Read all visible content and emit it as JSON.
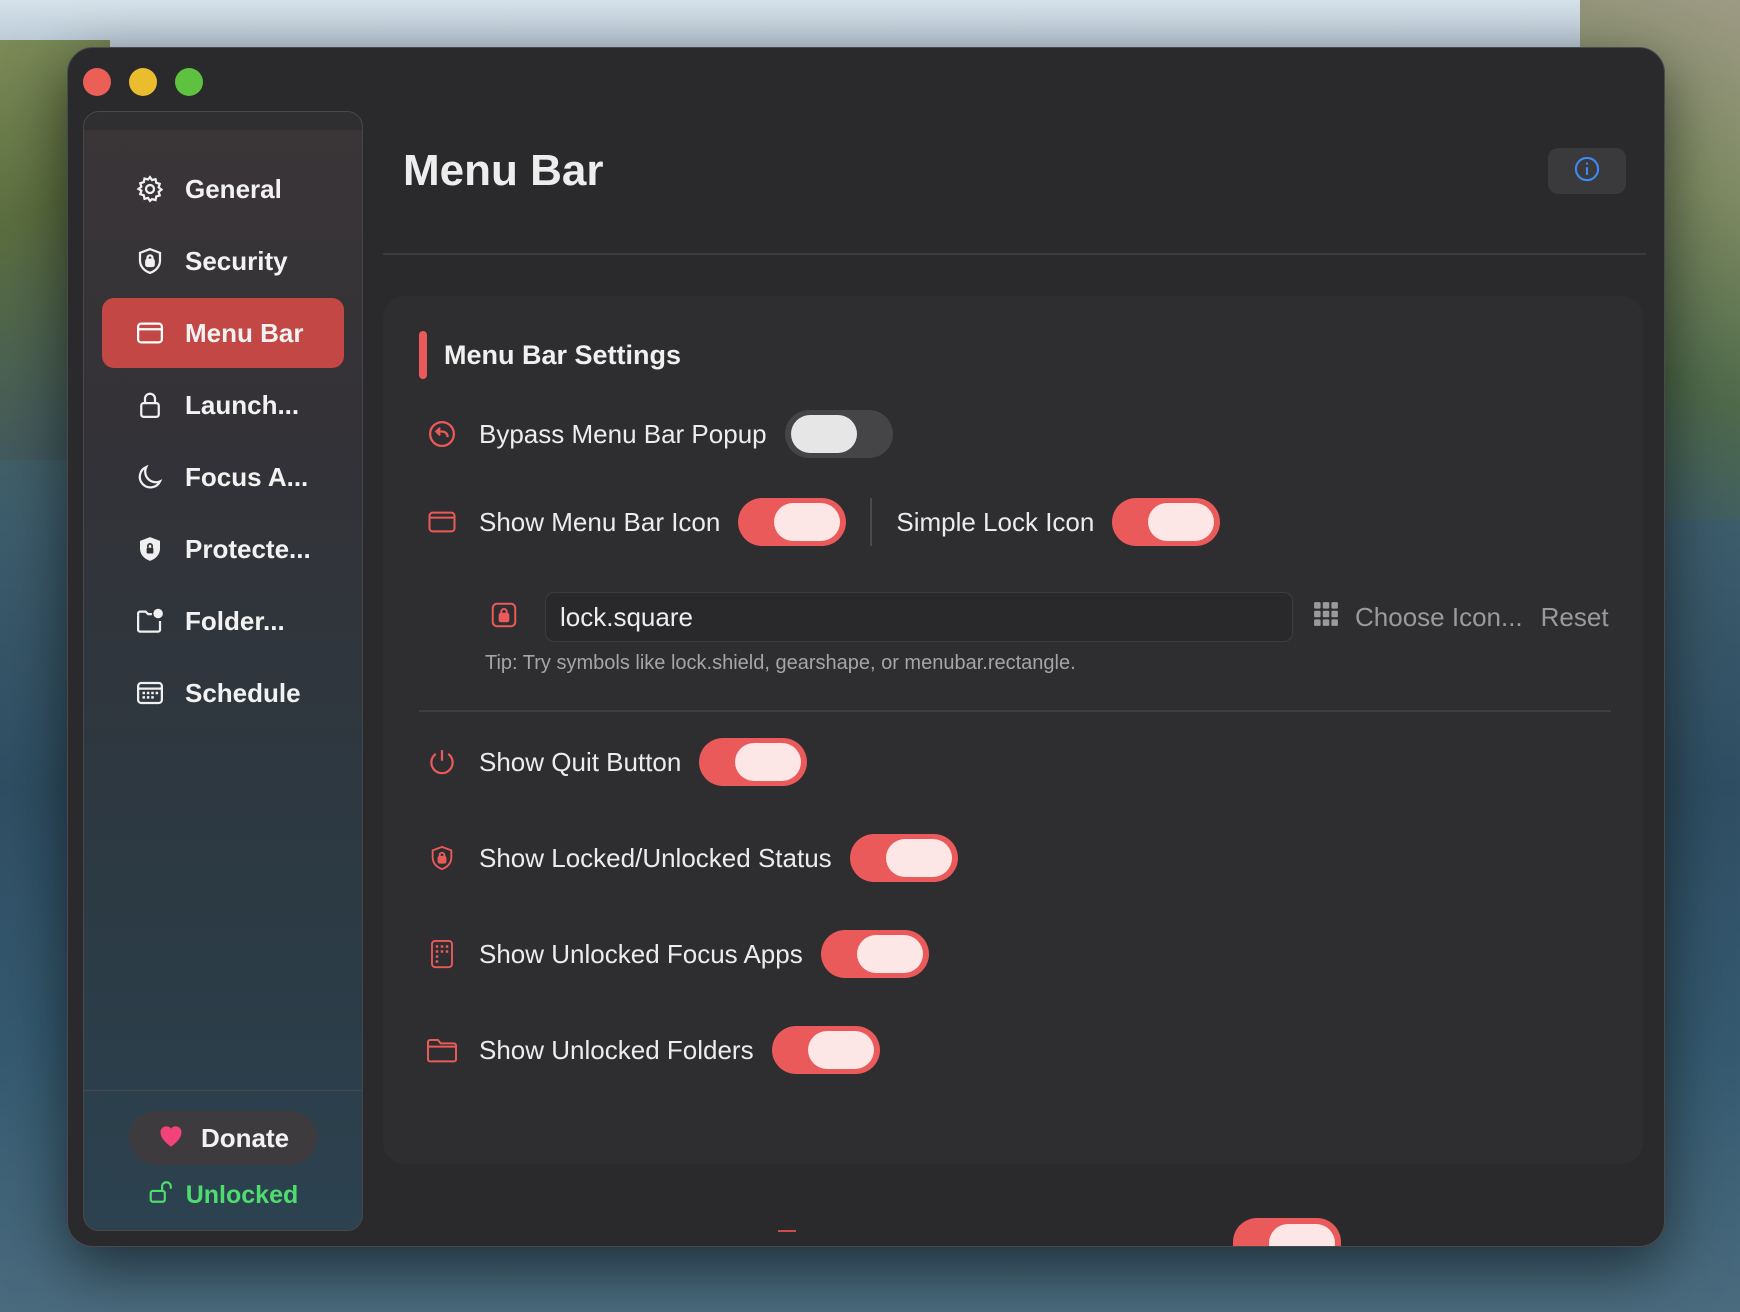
{
  "window": {
    "title": ""
  },
  "sidebar": {
    "items": [
      {
        "id": "general",
        "label": "General",
        "icon": "gear-icon",
        "active": false
      },
      {
        "id": "security",
        "label": "Security",
        "icon": "shield-lock-icon",
        "active": false
      },
      {
        "id": "menu-bar",
        "label": "Menu Bar",
        "icon": "menubar-rectangle-icon",
        "active": true
      },
      {
        "id": "launch",
        "label": "Launch...",
        "icon": "lock-icon",
        "active": false
      },
      {
        "id": "focus",
        "label": "Focus A...",
        "icon": "moon-icon",
        "active": false
      },
      {
        "id": "protected",
        "label": "Protecte...",
        "icon": "shield-badge-icon",
        "active": false
      },
      {
        "id": "folder",
        "label": "Folder...",
        "icon": "folder-badge-icon",
        "active": false
      },
      {
        "id": "schedule",
        "label": "Schedule",
        "icon": "calendar-icon",
        "active": false
      }
    ],
    "donate_label": "Donate",
    "status_label": "Unlocked"
  },
  "main": {
    "title": "Menu Bar",
    "section_title": "Menu Bar Settings",
    "bypass_popup": {
      "label": "Bypass Menu Bar Popup",
      "on": false
    },
    "show_menu_bar_icon": {
      "label": "Show Menu Bar Icon",
      "on": true
    },
    "simple_lock_icon": {
      "label": "Simple Lock Icon",
      "on": true
    },
    "icon_field": {
      "value": "lock.square"
    },
    "choose_icon_label": "Choose Icon...",
    "reset_label": "Reset",
    "tip": "Tip: Try symbols like lock.shield, gearshape, or menubar.rectangle.",
    "show_quit_button": {
      "label": "Show Quit Button",
      "on": true
    },
    "show_locked_status": {
      "label": "Show Locked/Unlocked Status",
      "on": true
    },
    "show_focus_apps": {
      "label": "Show Unlocked Focus Apps",
      "on": true
    },
    "show_folders": {
      "label": "Show Unlocked Folders",
      "on": true
    }
  },
  "colors": {
    "accent": "#ea5a5a",
    "active_nav": "#c24745",
    "unlocked_green": "#4fdc6e",
    "info_blue": "#3d8bf2"
  }
}
